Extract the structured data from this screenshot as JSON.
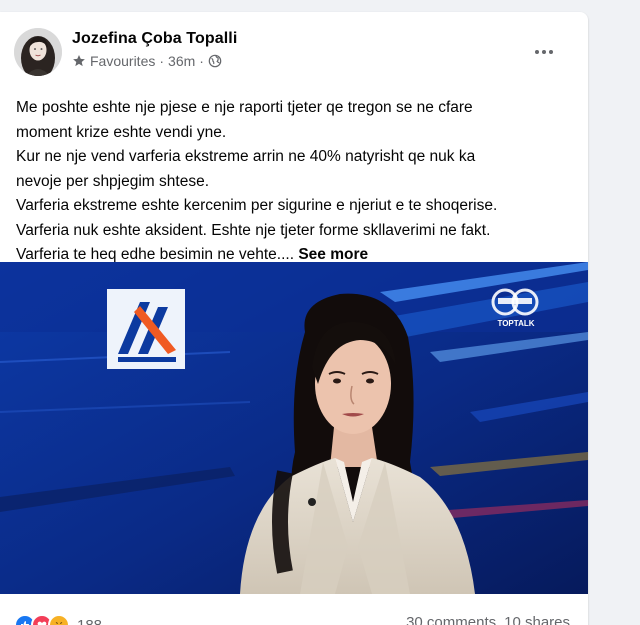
{
  "post": {
    "author": "Jozefina Çoba Topalli",
    "audience": "Favourites",
    "separator": "·",
    "time": "36m",
    "text_lines": [
      "Me poshte eshte nje pjese e nje raporti tjeter qe tregon se ne cfare",
      "moment krize eshte vendi yne.",
      "Kur ne nje vend varferia ekstreme arrin ne 40% natyrisht qe nuk  ka",
      "nevoje per shpjegim shtese.",
      "Varferia ekstreme eshte kercenim per sigurine e njeriut e te shoqerise.",
      "Varferia nuk eshte aksident. Eshte nje tjeter forme skllaverimi ne fakt.",
      "Varferia te heq edhe besimin ne vehte...."
    ],
    "see_more": "See more",
    "media": {
      "channel_badge": "TOPTALK",
      "icon": "tv-studio-photo"
    },
    "footer": {
      "reaction_count": "188",
      "comments": "30 comments",
      "shares": "10 shares"
    }
  },
  "icons": {
    "star": "star-icon",
    "globe": "globe-icon",
    "more": "more-options-icon",
    "like": "like-reaction-icon",
    "love": "love-reaction-icon",
    "haha": "haha-reaction-icon"
  },
  "colors": {
    "text": "#050505",
    "secondary": "#65676b",
    "like_blue": "#1877f2",
    "love_red": "#f33e58",
    "haha_yellow": "#f7b125",
    "studio_blue": "#0a2a7a"
  }
}
